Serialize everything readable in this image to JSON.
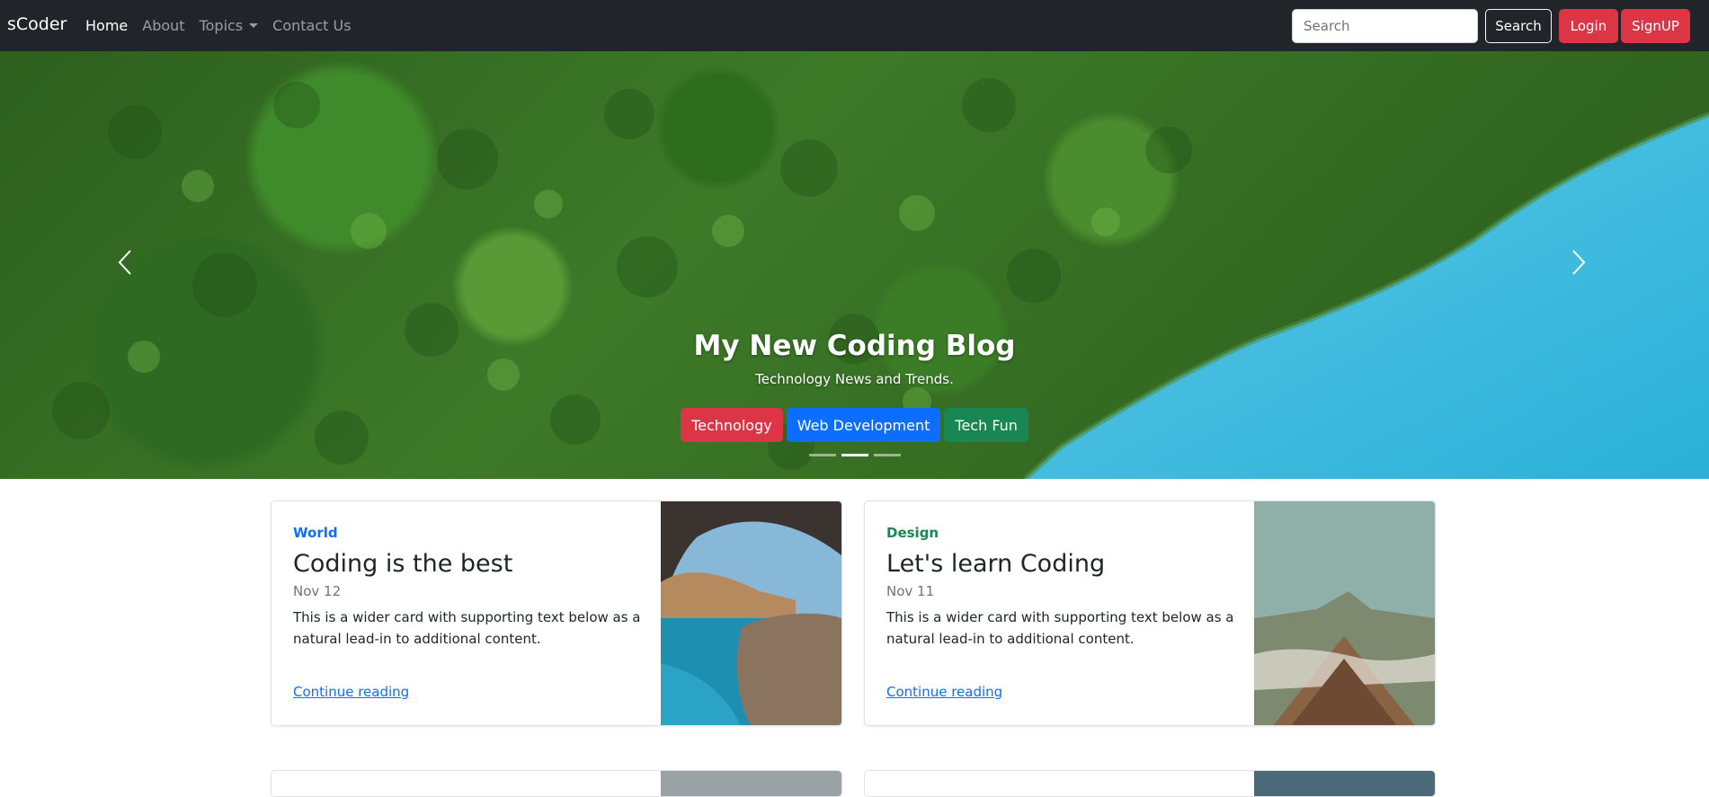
{
  "nav": {
    "brand": "sCoder",
    "links": [
      {
        "label": "Home",
        "active": true
      },
      {
        "label": "About",
        "active": false
      },
      {
        "label": "Topics",
        "active": false,
        "dropdown": true
      },
      {
        "label": "Contact Us",
        "active": false
      }
    ],
    "search_placeholder": "Search",
    "search_button": "Search",
    "login_button": "Login",
    "signup_button": "SignUP"
  },
  "hero": {
    "title": "My New Coding Blog",
    "subtitle": "Technology News and Trends.",
    "buttons": [
      {
        "label": "Technology",
        "color": "#dc3545"
      },
      {
        "label": "Web Development",
        "color": "#0d6efd"
      },
      {
        "label": "Tech Fun",
        "color": "#198754"
      }
    ],
    "indicators": 3,
    "active_indicator": 1
  },
  "cards": [
    {
      "category": "World",
      "category_color": "#0d6efd",
      "title": "Coding is the best",
      "date": "Nov 12",
      "text": "This is a wider card with supporting text below as a natural lead-in to additional content.",
      "link": "Continue reading"
    },
    {
      "category": "Design",
      "category_color": "#198754",
      "title": "Let's learn Coding",
      "date": "Nov 11",
      "text": "This is a wider card with supporting text below as a natural lead-in to additional content.",
      "link": "Continue reading"
    }
  ]
}
